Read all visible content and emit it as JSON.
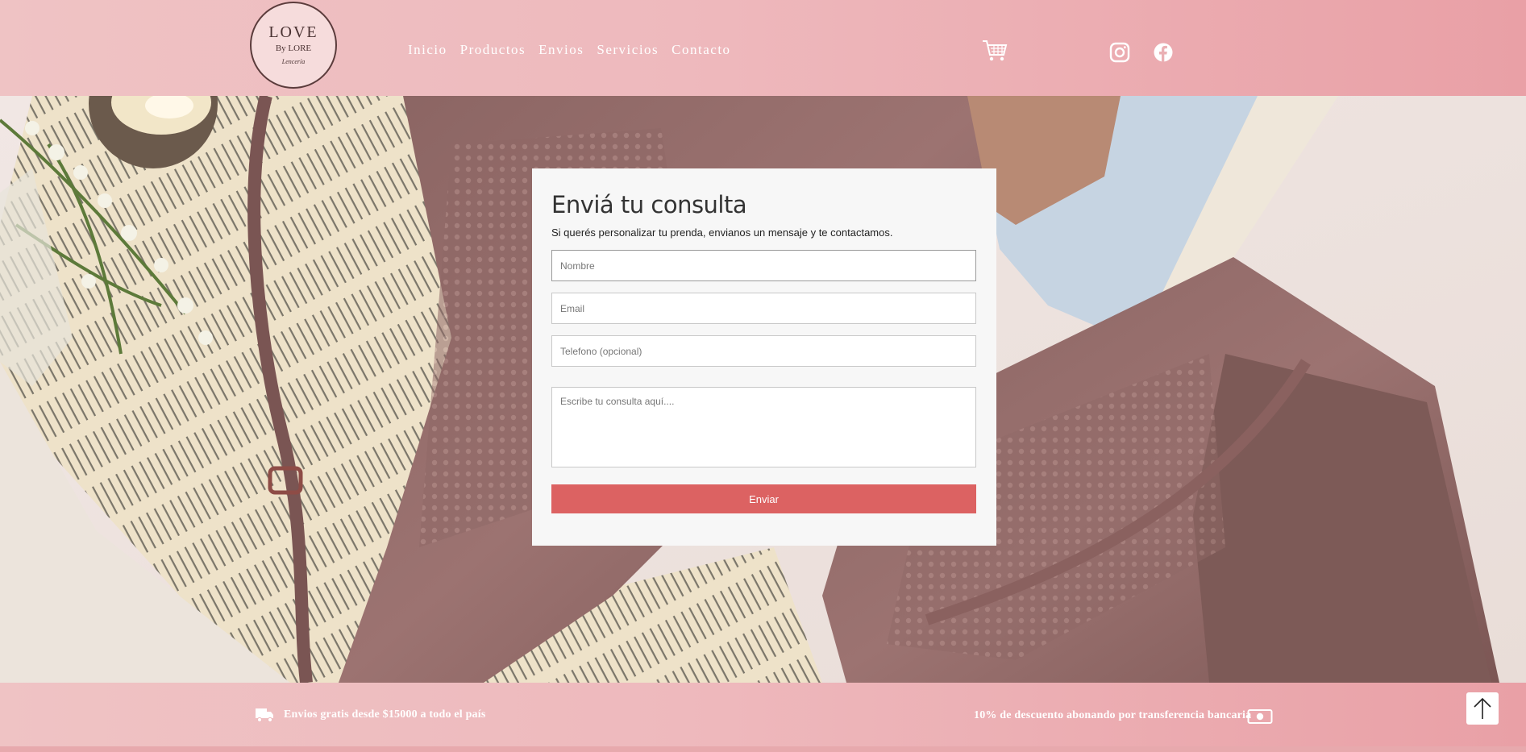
{
  "header": {
    "logo": {
      "line1": "LOVE",
      "line2": "By LORE",
      "line3": "Lencería"
    },
    "nav": [
      "Inicio",
      "Productos",
      "Envios",
      "Servicios",
      "Contacto"
    ],
    "icons": {
      "cart": "cart-icon",
      "instagram": "instagram-icon",
      "facebook": "facebook-icon"
    }
  },
  "form": {
    "title": "Enviá tu consulta",
    "subtitle": "Si querés personalizar tu prenda, envianos un mensaje y te contactamos.",
    "name_placeholder": "Nombre",
    "email_placeholder": "Email",
    "phone_placeholder": "Telefono (opcional)",
    "message_placeholder": "Escribe tu consulta aquí....",
    "submit_label": "Enviar"
  },
  "footer": {
    "shipping_text": "Envios gratis desde $15000 a todo el país",
    "discount_text": "10% de descuento abonando por transferencia bancaria",
    "icons": {
      "truck": "truck-icon",
      "bill": "money-bill-icon",
      "top": "arrow-up-icon"
    }
  },
  "colors": {
    "header_bg": "#eeb9bd",
    "accent_button": "#dc6262",
    "card_bg": "#f7f7f7"
  }
}
